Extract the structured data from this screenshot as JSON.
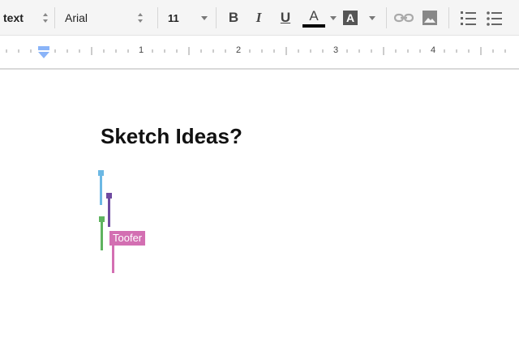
{
  "toolbar": {
    "style_select": {
      "value": "text"
    },
    "font_select": {
      "value": "Arial"
    },
    "size_select": {
      "value": "11"
    },
    "bold_label": "B",
    "italic_label": "I",
    "underline_label": "U",
    "text_color_label": "A",
    "highlight_label": "A"
  },
  "ruler": {
    "numbers": [
      "1",
      "2",
      "3",
      "4"
    ]
  },
  "document": {
    "title": "Sketch Ideas?",
    "collaborator_label": "Toofer"
  },
  "colors": {
    "cursor_blue": "#6cb8e4",
    "cursor_purple": "#6f4aa0",
    "cursor_green": "#5fb35f",
    "cursor_pink": "#d36fb2",
    "text_color_bar": "#000000",
    "ruler_indent": "#8ab4f8"
  }
}
